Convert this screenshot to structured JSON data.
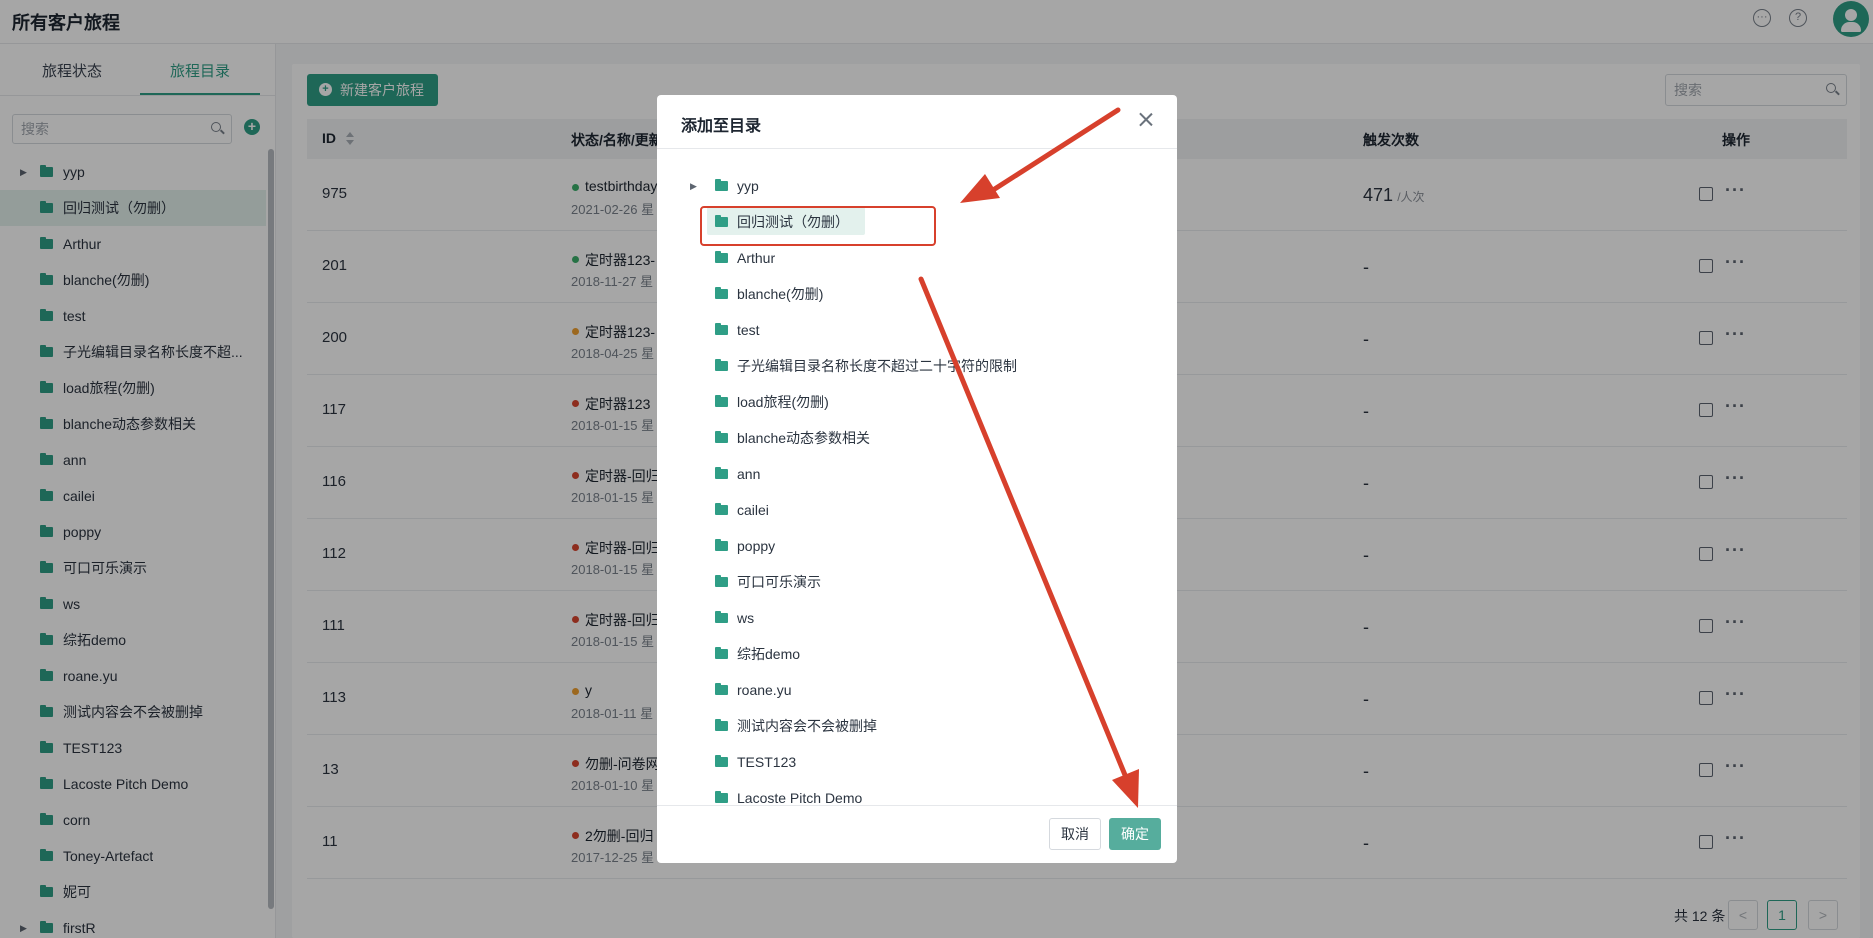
{
  "app": {
    "title": "所有客户旅程",
    "icons": [
      "message-icon",
      "help-icon",
      "avatar"
    ]
  },
  "sidebar": {
    "tabs": [
      {
        "label": "旅程状态",
        "active": false
      },
      {
        "label": "旅程目录",
        "active": true
      }
    ],
    "search_placeholder": "搜索",
    "items": [
      {
        "label": "yyp",
        "expandable": true,
        "selected": false
      },
      {
        "label": "回归测试（勿删）",
        "expandable": false,
        "selected": true
      },
      {
        "label": "Arthur",
        "expandable": false,
        "selected": false
      },
      {
        "label": "blanche(勿删)",
        "expandable": false,
        "selected": false
      },
      {
        "label": "test",
        "expandable": false,
        "selected": false
      },
      {
        "label": "子光编辑目录名称长度不超...",
        "expandable": false,
        "selected": false
      },
      {
        "label": "load旅程(勿删)",
        "expandable": false,
        "selected": false
      },
      {
        "label": "blanche动态参数相关",
        "expandable": false,
        "selected": false
      },
      {
        "label": "ann",
        "expandable": false,
        "selected": false
      },
      {
        "label": "cailei",
        "expandable": false,
        "selected": false
      },
      {
        "label": "poppy",
        "expandable": false,
        "selected": false
      },
      {
        "label": "可口可乐演示",
        "expandable": false,
        "selected": false
      },
      {
        "label": "ws",
        "expandable": false,
        "selected": false
      },
      {
        "label": "综拓demo",
        "expandable": false,
        "selected": false
      },
      {
        "label": "roane.yu",
        "expandable": false,
        "selected": false
      },
      {
        "label": "测试内容会不会被删掉",
        "expandable": false,
        "selected": false
      },
      {
        "label": "TEST123",
        "expandable": false,
        "selected": false
      },
      {
        "label": "Lacoste Pitch Demo",
        "expandable": false,
        "selected": false
      },
      {
        "label": "corn",
        "expandable": false,
        "selected": false
      },
      {
        "label": "Toney-Artefact",
        "expandable": false,
        "selected": false
      },
      {
        "label": "妮可",
        "expandable": false,
        "selected": false
      },
      {
        "label": "firstR",
        "expandable": true,
        "selected": false
      }
    ]
  },
  "main": {
    "new_button": "新建客户旅程",
    "search_placeholder": "搜索",
    "columns": {
      "id": "ID",
      "status": "状态/名称/更新",
      "count": "触发次数",
      "actions": "操作"
    },
    "rows": [
      {
        "id": "975",
        "status": "green",
        "name": "testbirthday",
        "date": "2021-02-26 星",
        "count": "471",
        "unit": "/人次"
      },
      {
        "id": "201",
        "status": "green",
        "name": "定时器123-",
        "date": "2018-11-27 星",
        "count": "-",
        "unit": ""
      },
      {
        "id": "200",
        "status": "orange",
        "name": "定时器123-",
        "date": "2018-04-25 星",
        "count": "-",
        "unit": ""
      },
      {
        "id": "117",
        "status": "red",
        "name": "定时器123",
        "date": "2018-01-15 星",
        "count": "-",
        "unit": ""
      },
      {
        "id": "116",
        "status": "red",
        "name": "定时器-回归",
        "date": "2018-01-15 星",
        "count": "-",
        "unit": ""
      },
      {
        "id": "112",
        "status": "red",
        "name": "定时器-回归",
        "date": "2018-01-15 星",
        "count": "-",
        "unit": ""
      },
      {
        "id": "111",
        "status": "red",
        "name": "定时器-回归",
        "date": "2018-01-15 星",
        "count": "-",
        "unit": ""
      },
      {
        "id": "113",
        "status": "orange",
        "name": "y",
        "date": "2018-01-11 星",
        "count": "-",
        "unit": ""
      },
      {
        "id": "13",
        "status": "red",
        "name": "勿删-问卷网",
        "date": "2018-01-10 星",
        "count": "-",
        "unit": ""
      },
      {
        "id": "11",
        "status": "red",
        "name": "2勿删-回归",
        "date": "2017-12-25 星",
        "count": "-",
        "unit": ""
      }
    ],
    "pagination": {
      "total": "共 12 条",
      "current": "1",
      "prev": "<",
      "next": ">"
    }
  },
  "modal": {
    "title": "添加至目录",
    "items": [
      {
        "label": "yyp",
        "expandable": true,
        "selected": false
      },
      {
        "label": "回归测试（勿删）",
        "expandable": false,
        "selected": true
      },
      {
        "label": "Arthur",
        "expandable": false,
        "selected": false
      },
      {
        "label": "blanche(勿删)",
        "expandable": false,
        "selected": false
      },
      {
        "label": "test",
        "expandable": false,
        "selected": false
      },
      {
        "label": "子光编辑目录名称长度不超过二十字符的限制",
        "expandable": false,
        "selected": false
      },
      {
        "label": "load旅程(勿删)",
        "expandable": false,
        "selected": false
      },
      {
        "label": "blanche动态参数相关",
        "expandable": false,
        "selected": false
      },
      {
        "label": "ann",
        "expandable": false,
        "selected": false
      },
      {
        "label": "cailei",
        "expandable": false,
        "selected": false
      },
      {
        "label": "poppy",
        "expandable": false,
        "selected": false
      },
      {
        "label": "可口可乐演示",
        "expandable": false,
        "selected": false
      },
      {
        "label": "ws",
        "expandable": false,
        "selected": false
      },
      {
        "label": "综拓demo",
        "expandable": false,
        "selected": false
      },
      {
        "label": "roane.yu",
        "expandable": false,
        "selected": false
      },
      {
        "label": "测试内容会不会被删掉",
        "expandable": false,
        "selected": false
      },
      {
        "label": "TEST123",
        "expandable": false,
        "selected": false
      },
      {
        "label": "Lacoste Pitch Demo",
        "expandable": false,
        "selected": false
      }
    ],
    "cancel": "取消",
    "confirm": "确定"
  },
  "colors": {
    "accent": "#2f9e86",
    "annotation": "#d7402c",
    "status_green": "#3bb06b",
    "status_orange": "#f0a030",
    "status_red": "#d9452f"
  }
}
